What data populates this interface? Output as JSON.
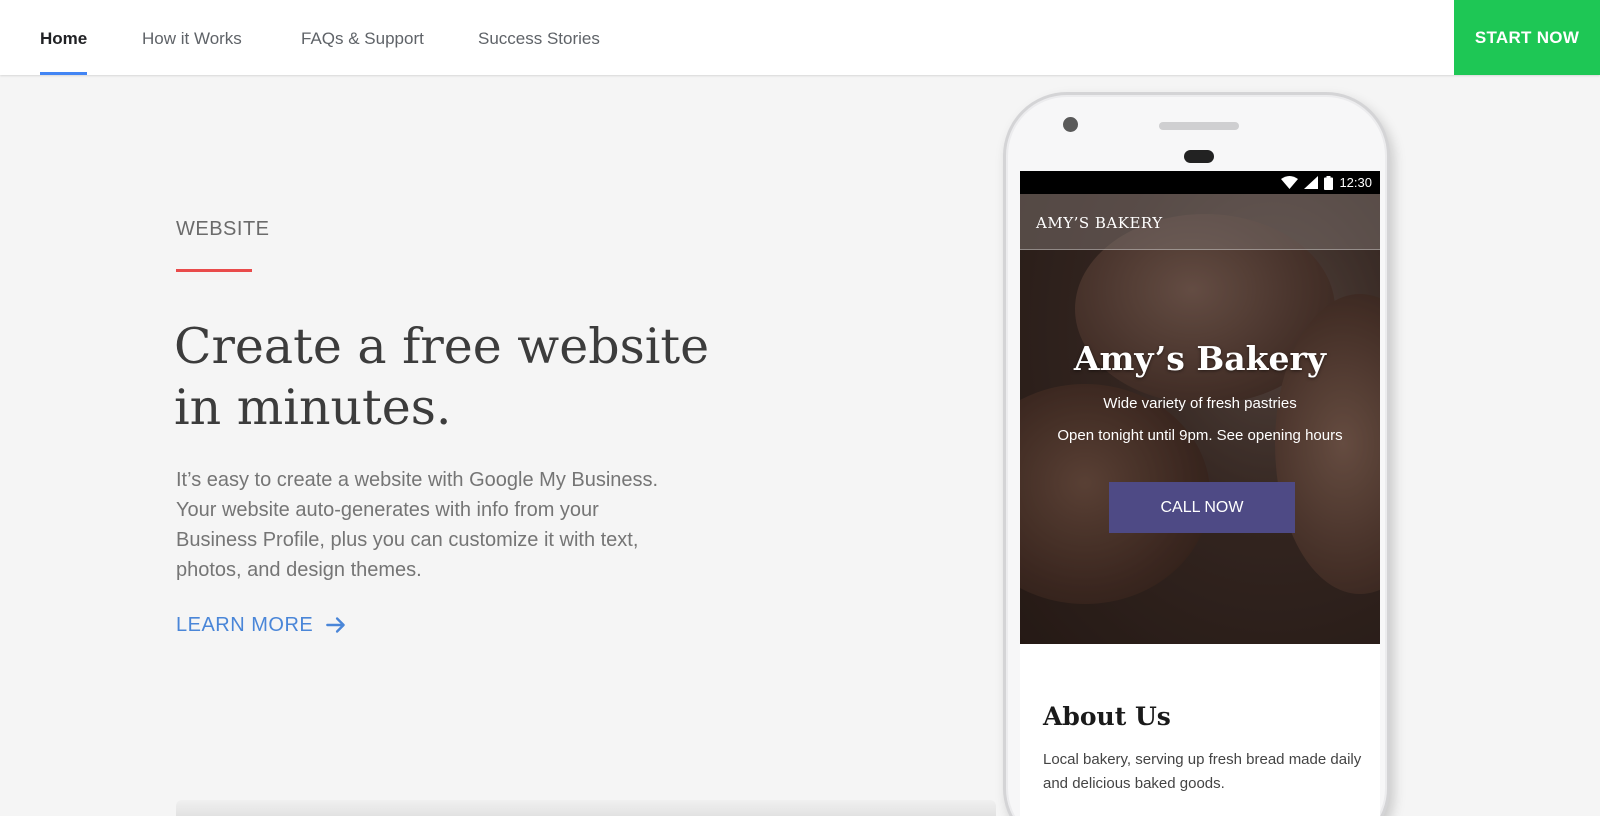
{
  "nav": {
    "items": [
      {
        "label": "Home",
        "active": true
      },
      {
        "label": "How it Works",
        "active": false
      },
      {
        "label": "FAQs & Support",
        "active": false
      },
      {
        "label": "Success Stories",
        "active": false
      }
    ],
    "cta_label": "START NOW"
  },
  "hero": {
    "eyebrow": "WEBSITE",
    "headline_line1": "Create a free website",
    "headline_line2": "in minutes.",
    "body": "It’s easy to create a website with Google My Business. Your website auto-generates with info from your Business Profile, plus you can customize it with text, photos, and design themes.",
    "learn_more": "LEARN MORE",
    "learn_more_icon": "arrow-right-icon"
  },
  "phone": {
    "status_time": "12:30",
    "site_name": "AMY’S BAKERY",
    "hero_title": "Amy’s Bakery",
    "hero_subtitle": "Wide variety of fresh pastries",
    "hero_hours": "Open tonight until 9pm. See opening hours",
    "call_button": "CALL NOW",
    "about_title": "About Us",
    "about_text": "Local bakery, serving up fresh bread made daily and delicious baked goods."
  },
  "colors": {
    "accent_blue": "#4285f4",
    "cta_green": "#1ec755",
    "eyebrow_rule_red": "#e94b4b",
    "link_blue": "#4a86d8",
    "call_button": "#4e4a85"
  }
}
